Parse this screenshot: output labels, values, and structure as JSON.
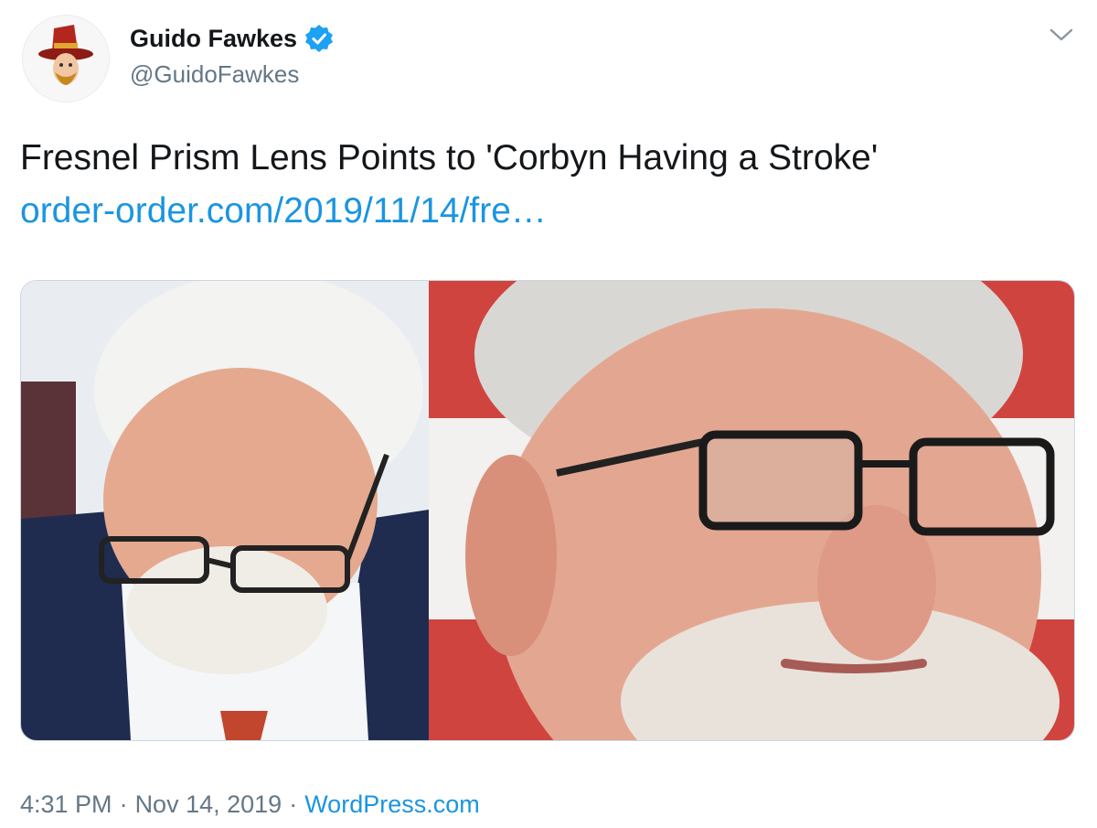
{
  "author": {
    "display_name": "Guido Fawkes",
    "handle": "@GuidoFawkes",
    "verified": true
  },
  "tweet": {
    "text": "Fresnel Prism Lens Points to 'Corbyn Having a Stroke'",
    "link_text": "order-order.com/2019/11/14/fre…"
  },
  "footer": {
    "time": "4:31 PM",
    "separator_1": "·",
    "date": "Nov 14, 2019",
    "separator_2": "·",
    "source": "WordPress.com"
  },
  "icons": {
    "verified": "verified-badge-icon",
    "menu": "chevron-down-icon"
  },
  "colors": {
    "link": "#1b95e0",
    "secondary_text": "#657786",
    "verified_blue": "#1da1f2"
  }
}
